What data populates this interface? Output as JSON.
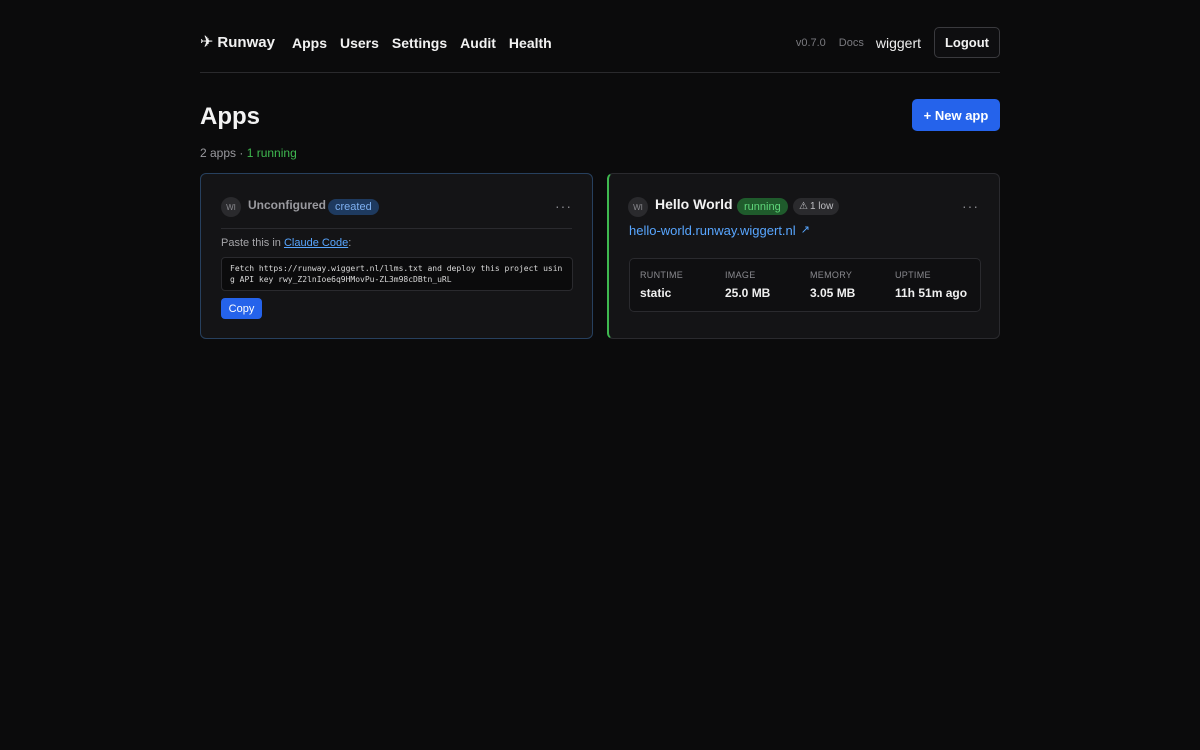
{
  "nav": {
    "brand": "Runway",
    "brand_icon": "airplane-icon",
    "links": [
      "Apps",
      "Users",
      "Settings",
      "Audit",
      "Health"
    ],
    "version": "v0.7.0",
    "docs": "Docs",
    "user": "wiggert",
    "logout": "Logout"
  },
  "page": {
    "title": "Apps",
    "new_app": "+ New app",
    "summary_count": "2 apps · ",
    "summary_running": "1 running"
  },
  "apps": [
    {
      "avatar": "WI",
      "name": "Unconfigured",
      "status": "created",
      "menu": "···",
      "paste_prefix": "Paste this in ",
      "paste_link": "Claude Code",
      "paste_suffix": ":",
      "command": "Fetch https://runway.wiggert.nl/llms.txt and deploy this project using API key rwy_Z2lnIoe6q9HMovPu-ZL3m98cDBtn_uRL",
      "copy": "Copy"
    },
    {
      "avatar": "WI",
      "name": "Hello World",
      "status": "running",
      "warning": "1 low",
      "warning_icon": "⚠",
      "menu": "···",
      "url": "hello-world.runway.wiggert.nl",
      "url_icon": "↗",
      "stats": {
        "runtime_label": "RUNTIME",
        "runtime": "static",
        "image_label": "IMAGE",
        "image": "25.0 MB",
        "memory_label": "MEMORY",
        "memory": "3.05 MB",
        "uptime_label": "UPTIME",
        "uptime": "11h 51m ago"
      }
    }
  ],
  "colors": {
    "background": "#0b0b0c",
    "accent": "#2563eb",
    "running": "#3fb950",
    "link": "#58a6ff"
  }
}
